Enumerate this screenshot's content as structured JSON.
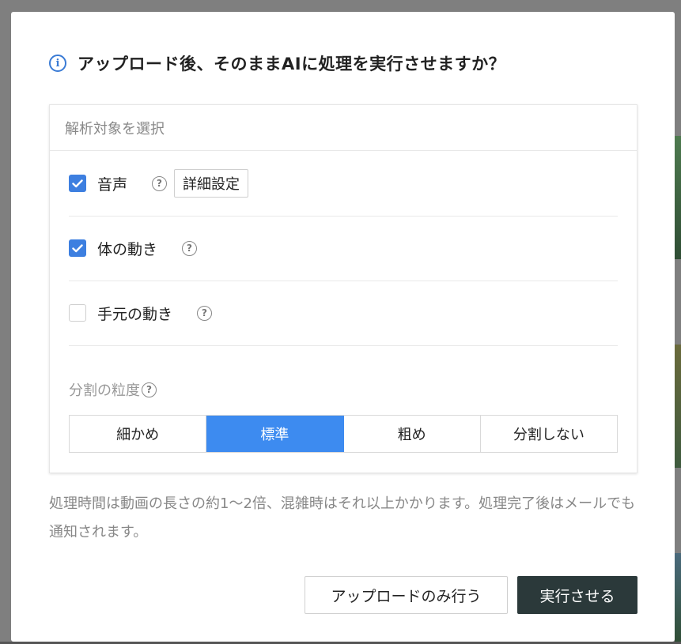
{
  "dialog": {
    "title": "アップロード後、そのままAIに処理を実行させますか？",
    "info_icon": "info-icon"
  },
  "panel": {
    "header": "解析対象を選択",
    "options": [
      {
        "label": "音声",
        "checked": true,
        "detail_button": "詳細設定"
      },
      {
        "label": "体の動き",
        "checked": true
      },
      {
        "label": "手元の動き",
        "checked": false
      }
    ],
    "help_glyph": "?",
    "granularity": {
      "label": "分割の粒度",
      "options": [
        "細かめ",
        "標準",
        "粗め",
        "分割しない"
      ],
      "selected": "標準"
    }
  },
  "note": "処理時間は動画の長さの約1〜2倍、混雑時はそれ以上かかります。処理完了後はメールでも通知されます。",
  "buttons": {
    "upload_only": "アップロードのみ行う",
    "run": "実行させる"
  },
  "colors": {
    "accent": "#3d8bf0",
    "checkbox": "#3d7fe0",
    "primary_button": "#2b393a",
    "info_icon": "#3a7bd5"
  }
}
